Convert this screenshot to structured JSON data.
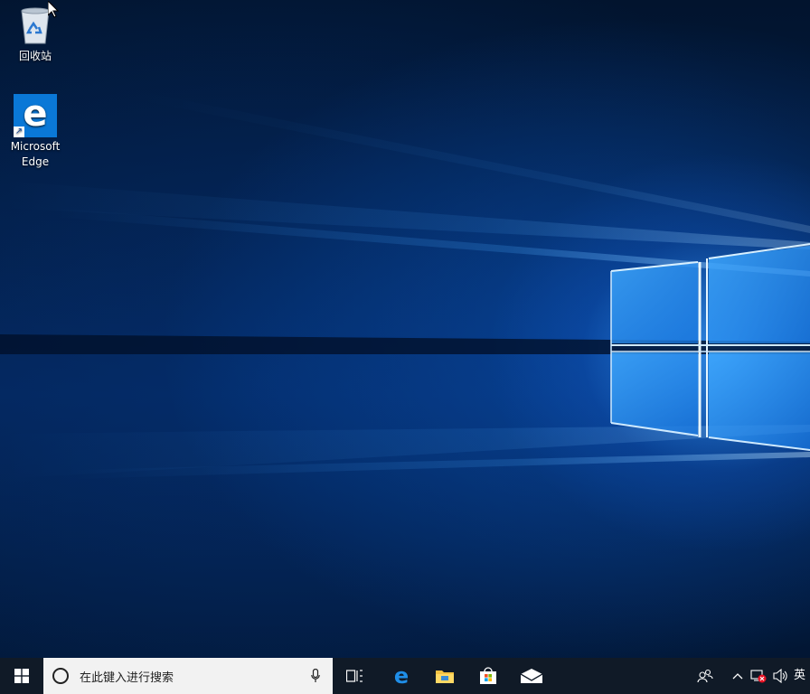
{
  "desktop": {
    "icons": [
      {
        "label": "回收站",
        "icon": "recycle-bin-icon"
      },
      {
        "label_line1": "Microsoft",
        "label_line2": "Edge",
        "icon": "edge-icon"
      }
    ]
  },
  "taskbar": {
    "search": {
      "placeholder": "在此键入进行搜索"
    },
    "pinned": [
      "task-view-icon",
      "edge-icon",
      "file-explorer-icon",
      "store-icon",
      "mail-icon"
    ],
    "tray": {
      "language": "英"
    }
  },
  "colors": {
    "taskbar_bg": "#101a27",
    "search_bg": "#f2f2f2",
    "edge_blue": "#0a78d7",
    "explorer_yellow": "#f5c342"
  }
}
